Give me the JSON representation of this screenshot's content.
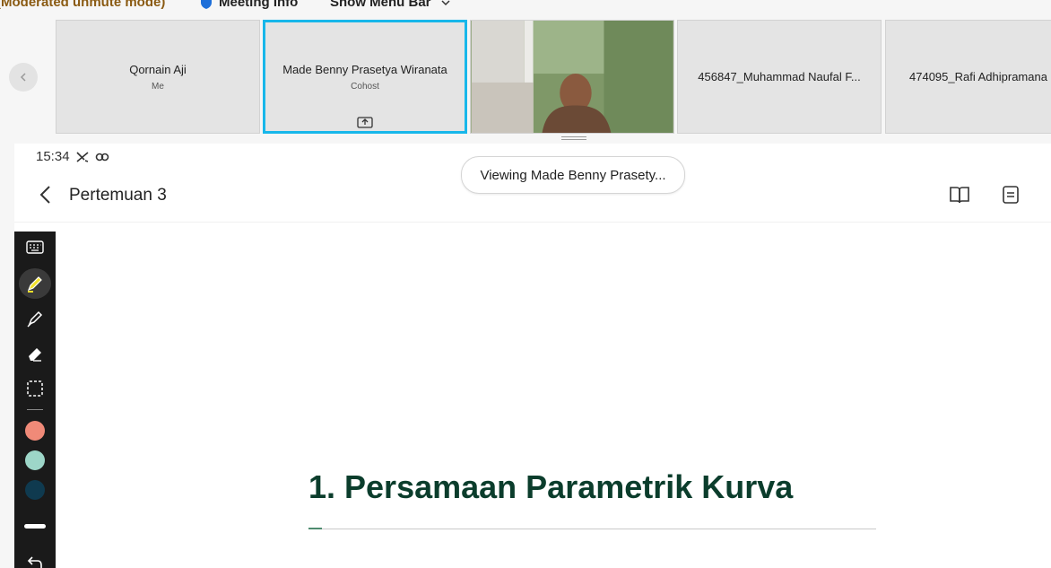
{
  "top_bar": {
    "moderated_text": "(Moderated unmute mode)",
    "meeting_info_label": "Meeting Info",
    "menu_bar_label": "Show Menu Bar"
  },
  "participants": [
    {
      "name": "Qornain Aji",
      "role": "Me"
    },
    {
      "name": "Made Benny Prasetya Wiranata",
      "role": "Cohost"
    },
    {
      "name": "",
      "role": ""
    },
    {
      "name": "456847_Muhammad Naufal F...",
      "role": ""
    },
    {
      "name": "474095_Rafi Adhipramana",
      "role": ""
    }
  ],
  "share": {
    "status_time": "15:34",
    "viewing_label": "Viewing Made Benny Prasety...",
    "document_title": "Pertemuan 3",
    "slide_heading": "1. Persamaan Parametrik Kurva"
  },
  "annotation": {
    "colors": [
      "#f08a78",
      "#9dd6c8",
      "#0f3a4f"
    ],
    "selected_tool": "highlighter",
    "highlight_color": "#f2e12b"
  },
  "accent_color": "#17b7ea"
}
